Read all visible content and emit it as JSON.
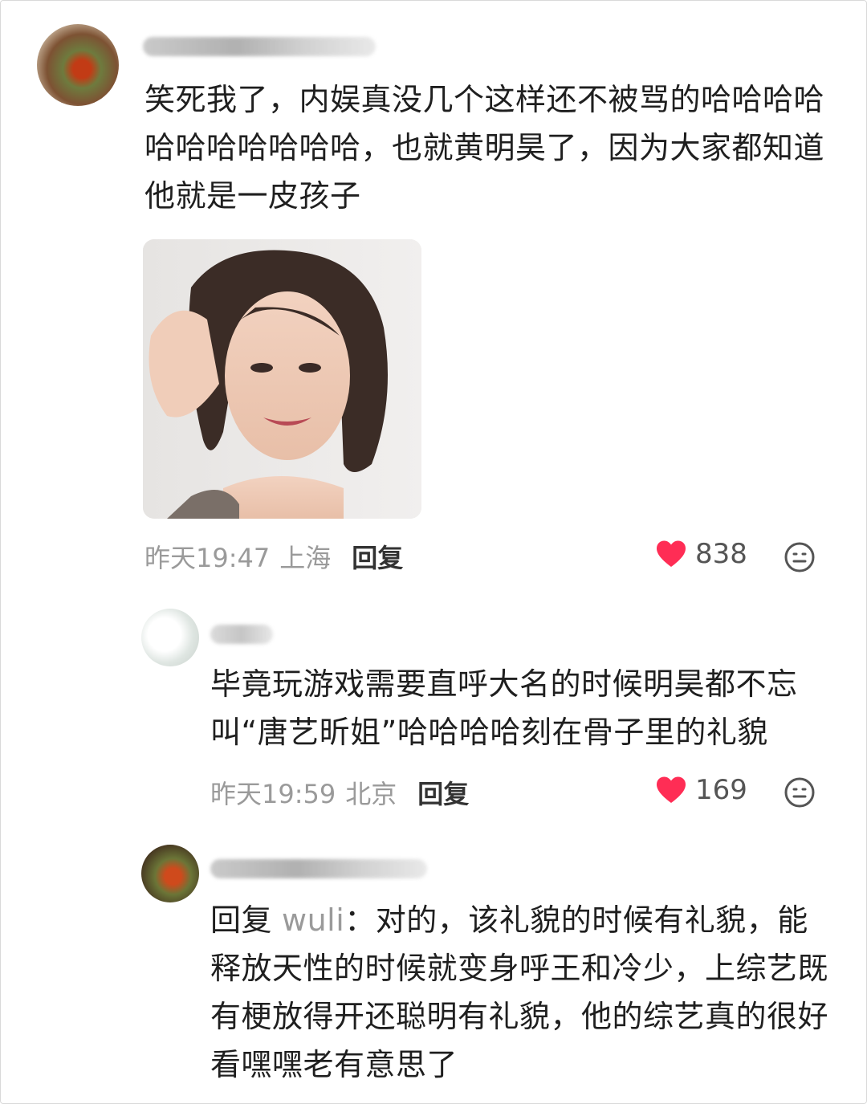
{
  "comments": {
    "main": {
      "text": "笑死我了，内娱真没几个这样还不被骂的哈哈哈哈哈哈哈哈哈哈哈，也就黄明昊了，因为大家都知道他就是一皮孩子",
      "time": "昨天19:47",
      "location": "上海",
      "reply_label": "回复",
      "likes": "838",
      "has_image": true
    },
    "reply1": {
      "text": "毕竟玩游戏需要直呼大名的时候明昊都不忘叫“唐艺昕姐”哈哈哈哈刻在骨子里的礼貌",
      "time": "昨天19:59",
      "location": "北京",
      "reply_label": "回复",
      "likes": "169"
    },
    "reply2": {
      "prefix": "回复",
      "reply_to": "wuli",
      "text": "：对的，该礼貌的时候有礼貌，能释放天性的时候就变身呼王和冷少，上综艺既有梗放得开还聪明有礼貌，他的综艺真的很好看嘿嘿老有意思了"
    }
  },
  "colors": {
    "heart": "#ff2d55",
    "meta_text": "#9a9a9a",
    "body_text": "#1f1f1f"
  },
  "icons": {
    "like": "heart-icon",
    "react": "emoji-face-icon"
  }
}
